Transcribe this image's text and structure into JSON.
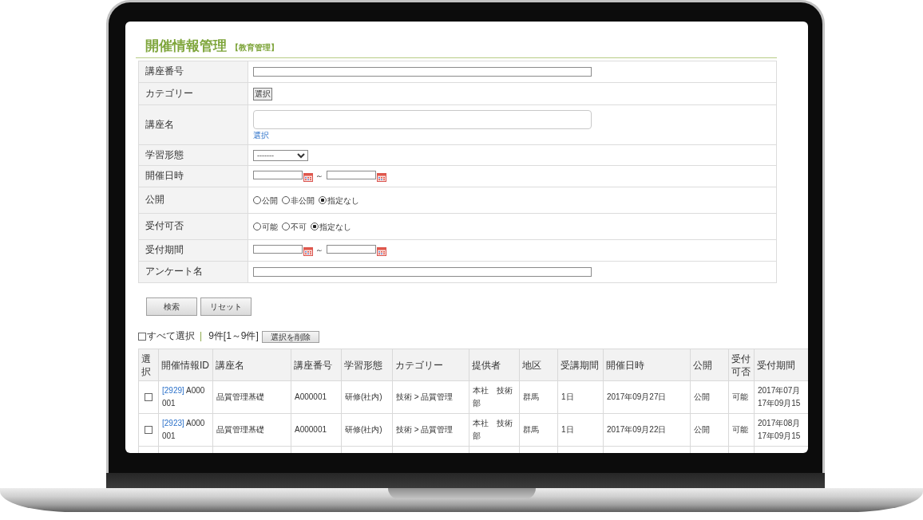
{
  "page": {
    "title": "開催情報管理",
    "subtitle": "【教育管理】"
  },
  "search_form": {
    "fields": [
      {
        "label": "講座番号",
        "kind": "text"
      },
      {
        "label": "カテゴリー",
        "kind": "button",
        "button": "選択"
      },
      {
        "label": "講座名",
        "kind": "textarea",
        "link": "選択"
      },
      {
        "label": "学習形態",
        "kind": "select",
        "value": "-------"
      },
      {
        "label": "開催日時",
        "kind": "date_range",
        "separator": "～"
      },
      {
        "label": "公開",
        "kind": "radio",
        "options": [
          {
            "label": "公開",
            "selected": false
          },
          {
            "label": "非公開",
            "selected": false
          },
          {
            "label": "指定なし",
            "selected": true
          }
        ]
      },
      {
        "label": "受付可否",
        "kind": "radio",
        "options": [
          {
            "label": "可能",
            "selected": false
          },
          {
            "label": "不可",
            "selected": false
          },
          {
            "label": "指定なし",
            "selected": true
          }
        ]
      },
      {
        "label": "受付期間",
        "kind": "date_range",
        "separator": "～"
      },
      {
        "label": "アンケート名",
        "kind": "text"
      }
    ]
  },
  "buttons": [
    "検索",
    "リセット"
  ],
  "list_toolbar": {
    "select_all": {
      "label": "すべて選択",
      "checked": false
    },
    "separator": "|",
    "count": "9件[1～9件]",
    "delete_button": "選択を削除"
  },
  "table": {
    "columns": [
      "選択",
      "開催情報ID",
      "講座名",
      "講座番号",
      "学習形態",
      "カテゴリー",
      "提供者",
      "地区",
      "受講期間",
      "開催日時",
      "公開",
      "受付可否",
      "受付期間"
    ],
    "rows": [
      {
        "cells": [
          {
            "checked": false
          },
          {
            "link": "[2929]",
            "text": "A000001"
          },
          {
            "text": "品質管理基礎"
          },
          {
            "text": "A000001"
          },
          {
            "text": "研修(社内)"
          },
          {
            "text": "技術 > 品質管理"
          },
          {
            "text": "本社　技術部"
          },
          {
            "text": "群馬"
          },
          {
            "text": "1日"
          },
          {
            "text": "2017年09月27日"
          },
          {
            "text": "公開"
          },
          {
            "text": "可能"
          },
          {
            "lines": [
              "2017年07月",
              "17年09月15"
            ]
          }
        ]
      },
      {
        "cells": [
          {
            "checked": false
          },
          {
            "link": "[2923]",
            "text": "A000001"
          },
          {
            "text": "品質管理基礎"
          },
          {
            "text": "A000001"
          },
          {
            "text": "研修(社内)"
          },
          {
            "text": "技術 > 品質管理"
          },
          {
            "text": "本社　技術部"
          },
          {
            "text": "群馬"
          },
          {
            "text": "1日"
          },
          {
            "text": "2017年09月22日"
          },
          {
            "text": "公開"
          },
          {
            "text": "可能"
          },
          {
            "lines": [
              "2017年08月",
              "17年09月15"
            ]
          }
        ]
      }
    ]
  }
}
